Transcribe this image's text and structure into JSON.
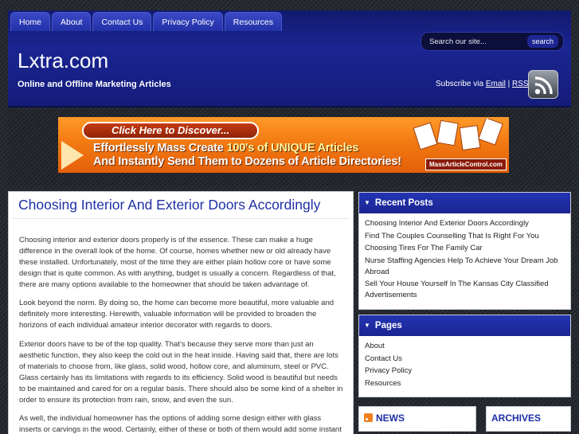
{
  "nav": {
    "items": [
      {
        "label": "Home"
      },
      {
        "label": "About"
      },
      {
        "label": "Contact Us"
      },
      {
        "label": "Privacy Policy"
      },
      {
        "label": "Resources"
      }
    ]
  },
  "search": {
    "placeholder": "Search our site...",
    "button_label": "search"
  },
  "site": {
    "title": "Lxtra.com",
    "tagline": "Online and Offline Marketing Articles"
  },
  "subscribe": {
    "prefix": "Subscribe via",
    "email_label": "Email",
    "separator": "|",
    "rss_label": "RSS",
    "rss_icon": "rss-feed-icon"
  },
  "banner": {
    "pill": "Click Here to Discover...",
    "line1_a": "Effortlessly Mass Create ",
    "line1_b": "100's of UNIQUE Articles",
    "line2": "And Instantly Send Them to Dozens of Article Directories!",
    "brand": "MassArticleControl.com",
    "colors": {
      "primary": "#f27a12",
      "highlight": "#fff5a0"
    }
  },
  "post": {
    "title": "Choosing Interior And Exterior Doors Accordingly",
    "paragraphs": [
      "Choosing interior and exterior doors properly is of the essence. These can make a huge difference in the overall look of the home. Of course, homes whether new or old already have these installed. Unfortunately, most of the time they are either plain hollow core or have some design that is quite common. As with anything, budget is usually a concern. Regardless of that, there are many options available to the homeowner that should be taken advantage of.",
      "Look beyond the norm. By doing so, the home can become more beautiful, more valuable and definitely more interesting. Herewith, valuable information will be provided to broaden the horizons of each individual amateur interior decorator with regards to doors.",
      "Exterior doors have to be of the top quality. That’s because they serve more than just an aesthetic function, they also keep the cold out in the heat inside. Having said that, there are lots of materials to choose from, like glass, solid wood, hollow core, and aluminum, steel or PVC. Glass certainly has its limitations with regards to its efficiency. Solid wood is beautiful but needs to be maintained and cared for on a regular basis. There should also be some kind of a shelter in order to ensure its protection from rain, snow, and even the sun.",
      "As well, the individual homeowner has the options of adding some design either with glass inserts or carvings in the wood. Certainly, either of these or both of them would add some instant"
    ]
  },
  "sidebar": {
    "recent_posts": {
      "heading": "Recent Posts",
      "items": [
        "Choosing Interior And Exterior Doors Accordingly",
        "Find The Couples Counselling That Is Right For You",
        "Choosing Tires For The Family Car",
        "Nurse Staffing Agencies Help To Achieve Your Dream Job Abroad",
        "Sell Your House Yourself In The Kansas City Classified Advertisements"
      ]
    },
    "pages": {
      "heading": "Pages",
      "items": [
        "About",
        "Contact Us",
        "Privacy Policy",
        "Resources"
      ]
    },
    "news_heading": "NEWS",
    "archives_heading": "ARCHIVES"
  },
  "colors": {
    "header_blue": "#1a2592",
    "link_blue": "#1e2fa6",
    "background": "#262a30"
  }
}
